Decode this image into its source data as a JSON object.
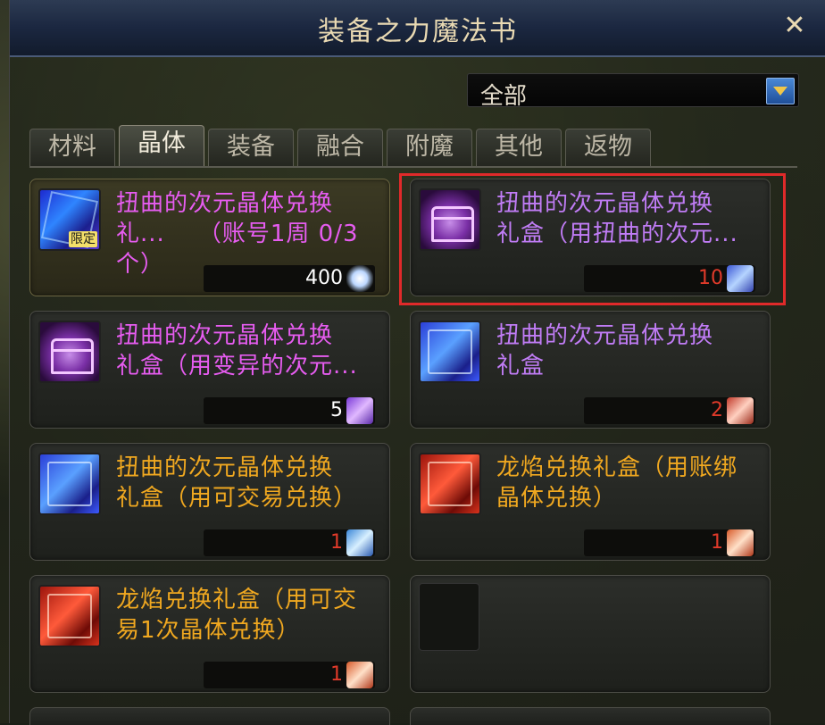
{
  "window": {
    "title": "装备之力魔法书",
    "close_glyph": "✕"
  },
  "filter": {
    "selected": "全部"
  },
  "tabs": [
    {
      "label": "材料",
      "active": false
    },
    {
      "label": "晶体",
      "active": true
    },
    {
      "label": "装备",
      "active": false
    },
    {
      "label": "融合",
      "active": false
    },
    {
      "label": "附魔",
      "active": false
    },
    {
      "label": "其他",
      "active": false
    },
    {
      "label": "返物",
      "active": false
    }
  ],
  "items": [
    {
      "line1": "扭曲的次元晶体兑换",
      "line2": "礼...    （账号1周 0/3个）",
      "price": "400",
      "color": "#e65cf0",
      "icon": "crystal-limited-icon",
      "gem": "white-crystal-icon",
      "limited": "限定"
    },
    {
      "line1": "扭曲的次元晶体兑换",
      "line2": "礼盒（用扭曲的次元...",
      "price": "10",
      "price_color": "#e03a2a",
      "color": "#c07cf5",
      "icon": "purple-chest-icon",
      "gem": "blue-crystal-icon"
    },
    {
      "line1": "扭曲的次元晶体兑换",
      "line2": "礼盒（用变异的次元...",
      "price": "5",
      "color": "#e65cf0",
      "icon": "purple-chest-icon",
      "gem": "purple-cube-icon"
    },
    {
      "line1": "扭曲的次元晶体兑换",
      "line2": "礼盒",
      "price": "2",
      "price_color": "#e03a2a",
      "color": "#c07cf5",
      "icon": "blue-crystal-box-icon",
      "gem": "red-cube-icon"
    },
    {
      "line1": "扭曲的次元晶体兑换",
      "line2": "礼盒（用可交易兑换）",
      "price": "1",
      "price_color": "#e03a2a",
      "color": "#f0a820",
      "icon": "blue-crystal-box-icon",
      "gem": "cyan-cube-icon"
    },
    {
      "line1": "龙焰兑换礼盒（用账绑",
      "line2": "晶体兑换）",
      "price": "1",
      "price_color": "#e03a2a",
      "color": "#f0a820",
      "icon": "red-crystal-box-icon",
      "gem": "orange-cube-icon"
    },
    {
      "line1": "龙焰兑换礼盒（用可交",
      "line2": "易1次晶体兑换）",
      "price": "1",
      "price_color": "#e03a2a",
      "color": "#f0a820",
      "icon": "red-crystal-box-icon",
      "gem": "orange-cube-icon"
    }
  ],
  "colors": {
    "highlight": "#e02a2a",
    "title_text": "#e9d9b2"
  }
}
